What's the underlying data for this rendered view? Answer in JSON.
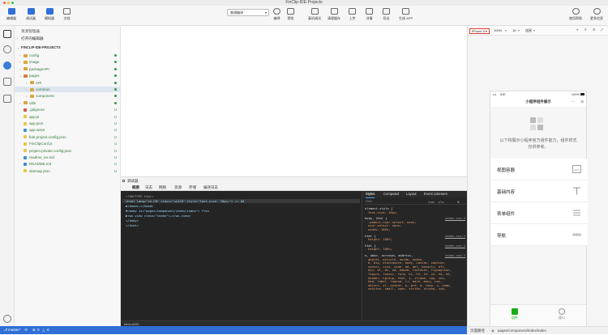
{
  "window": {
    "title": "FinClip-IDE-Projects"
  },
  "toolbar": {
    "left_buttons": [
      {
        "label": "编辑器",
        "icon": "code-icon"
      },
      {
        "label": "调试器",
        "icon": "debug-icon"
      },
      {
        "label": "模拟器",
        "icon": "simulator-icon"
      },
      {
        "label": "文档",
        "icon": "doc-icon"
      }
    ],
    "compile_select": "普通编译",
    "compile_buttons": [
      {
        "label": "编译",
        "icon": "refresh-icon"
      },
      {
        "label": "预览",
        "icon": "eye-icon"
      }
    ],
    "right_buttons": [
      {
        "label": "真机调试",
        "icon": "phone-debug-icon"
      },
      {
        "label": "清理缓存",
        "icon": "clear-icon"
      },
      {
        "label": "上传",
        "icon": "upload-icon"
      },
      {
        "label": "详情",
        "icon": "details-icon"
      },
      {
        "label": "导出",
        "icon": "export-icon"
      },
      {
        "label": "生成 APP",
        "icon": "app-icon"
      }
    ],
    "far_right_buttons": [
      {
        "label": "使用帮助",
        "icon": "help-icon"
      },
      {
        "label": "更多信息",
        "icon": "user-icon"
      }
    ]
  },
  "explorer": {
    "title": "资源管理器",
    "open_editors": "打开的编辑器",
    "project": "FINCLIP-IDE-PROJECTS",
    "items": [
      {
        "name": "config",
        "type": "folder",
        "status": "dot",
        "depth": 1,
        "color": "#d9a441"
      },
      {
        "name": "image",
        "type": "folder",
        "status": "dot",
        "depth": 1,
        "color": "#d9a441"
      },
      {
        "name": "packageAPI",
        "type": "folder",
        "status": "dot",
        "depth": 1,
        "color": "#d9a441"
      },
      {
        "name": "pages",
        "type": "folder",
        "status": "dot",
        "depth": 1,
        "open": true,
        "color": "#d97a3a"
      },
      {
        "name": "API",
        "type": "folder",
        "status": "dot",
        "depth": 2,
        "color": "#d9a441"
      },
      {
        "name": "common",
        "type": "folder",
        "status": "dot",
        "depth": 2,
        "selected": true,
        "color": "#d9a441"
      },
      {
        "name": "component",
        "type": "folder",
        "status": "dot",
        "depth": 2,
        "color": "#d9a441"
      },
      {
        "name": "utils",
        "type": "folder",
        "status": "dot",
        "depth": 1,
        "color": "#d9a441"
      },
      {
        "name": ".gitignore",
        "type": "file",
        "status": "U",
        "depth": 1,
        "color": "#d9534f"
      },
      {
        "name": "app.js",
        "type": "file",
        "status": "U",
        "depth": 1,
        "color": "#e8c547"
      },
      {
        "name": "app.json",
        "type": "file",
        "status": "U",
        "depth": 1,
        "color": "#e8c547"
      },
      {
        "name": "app.wxss",
        "type": "file",
        "status": "U",
        "depth": 1,
        "color": "#3b8ed0"
      },
      {
        "name": "fide.project.config.json",
        "type": "file",
        "status": "U",
        "depth": 1,
        "color": "#e8c547"
      },
      {
        "name": "FinClipConf.js",
        "type": "file",
        "status": "U",
        "depth": 1,
        "color": "#e8c547"
      },
      {
        "name": "project.private.config.json",
        "type": "file",
        "status": "U",
        "depth": 1,
        "color": "#e8c547"
      },
      {
        "name": "readme_en.md",
        "type": "file",
        "status": "U",
        "depth": 1,
        "color": "#3b8ed0"
      },
      {
        "name": "README.md",
        "type": "file",
        "status": "U",
        "depth": 1,
        "color": "#3b8ed0"
      },
      {
        "name": "sitemap.json",
        "type": "file",
        "status": "U",
        "depth": 1,
        "color": "#e8c547"
      }
    ]
  },
  "debugger": {
    "title": "调试器",
    "tabs": [
      "概要",
      "日志",
      "网络",
      "资源",
      "存储",
      "编译日志"
    ],
    "code_lines": [
      "<!DOCTYPE html>",
      "<html lang=\"zh-CN\" class=\"ui220\" style=\"font-size: 18px;\"> == $0",
      "  ▶<head>…</head>",
      "  ▼<body is=\"pages/component/index/index\"> flex",
      "    ▶<wx-view class=\"index\">…</wx-view>",
      "    </body>",
      "</html>"
    ],
    "flex_badge": "flex",
    "styles_tabs": [
      "Styles",
      "Computed",
      "Layout",
      "Event Listeners"
    ],
    "filter_placeholder": "Filter",
    "filter_tools": ":hov .cls",
    "style_rules": [
      {
        "selector": "element.style {",
        "source": "",
        "props": [
          "font-size: 18px;"
        ]
      },
      {
        "selector": "body, html {",
        "source": "index.css:2",
        "props": [
          "-webkit-user-select: none;",
          "user-select: none;",
          "width: 100%;"
        ]
      },
      {
        "selector": "html {",
        "source": "index.css:1",
        "props": [
          "height: 100%;"
        ]
      },
      {
        "selector": "html {",
        "source": "index.css:1",
        "props": [
          "height: 100%;"
        ]
      },
      {
        "selector": "a, abbr, acronym, address,",
        "source": "index.css:1",
        "props": [
          "applet, article, aside, audio,",
          "b, big, blockquote, body, canvas, caption,",
          "center, cite, code, dd, del, details, dfn,",
          "div, dl, dt, em, embed, fieldset, figcaption,",
          "figure, footer, form, h1, h2, h3, h4, h5, h6,",
          "header, hgroup, html, i, iframe, img, ins,",
          "kbd, label, legend, li, mark, menu, nav,",
          "object, ol, output, p, pre, q, ruby, s, samp,",
          "section, small, span, strike, strong, sub,"
        ]
      }
    ],
    "breadcrumb": "html.ui220"
  },
  "statusbar": {
    "branch": "master*",
    "sync": "⟲",
    "errors": "0",
    "warnings": "0"
  },
  "preview": {
    "device": "iPhone 6",
    "zoom": "100%",
    "font": "16",
    "mode": "连接",
    "phone_status_left": "IDE",
    "phone_status_time": "",
    "phone_battery": "100%",
    "nav_title": "小程序组件展示",
    "intro": "以下将展示小程序官方组件能力，组件样式仅供参考。",
    "menu_items": [
      {
        "label": "视图容器",
        "icon": "view-icon"
      },
      {
        "label": "基础内容",
        "icon": "text-icon"
      },
      {
        "label": "表单组件",
        "icon": "form-icon"
      },
      {
        "label": "导航",
        "icon": "nav-icon"
      }
    ],
    "tabbar": [
      {
        "label": "组件",
        "active": true
      },
      {
        "label": "接口",
        "active": false
      }
    ],
    "page_path_label": "页面路径",
    "page_path": "pages/component/index/index"
  }
}
